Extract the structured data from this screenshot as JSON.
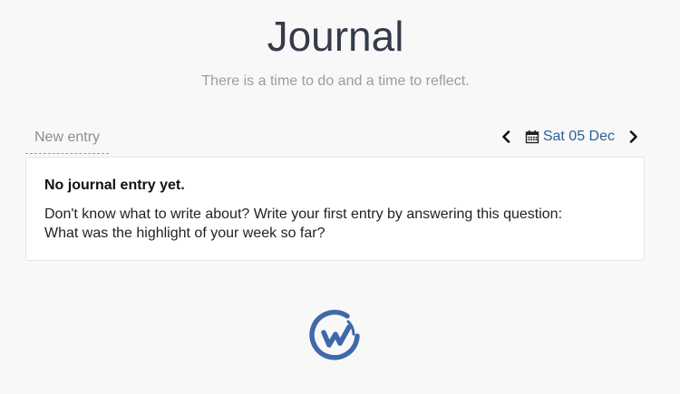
{
  "header": {
    "title": "Journal",
    "subtitle": "There is a time to do and a time to reflect."
  },
  "tabs": {
    "new_entry": "New entry"
  },
  "date_nav": {
    "date": "Sat 05 Dec",
    "prev_icon": "chevron-left-icon",
    "next_icon": "chevron-right-icon",
    "calendar_icon": "calendar-icon"
  },
  "card": {
    "title": "No journal entry yet.",
    "line1": "Don't know what to write about? Write your first entry by answering this question:",
    "line2": "What was the highlight of your week so far?"
  },
  "logo": {
    "icon": "brand-logo-icon",
    "color": "#3f69a8"
  },
  "colors": {
    "accent": "#2c5f98",
    "background": "#f8f8f9",
    "title": "#363b4a"
  }
}
